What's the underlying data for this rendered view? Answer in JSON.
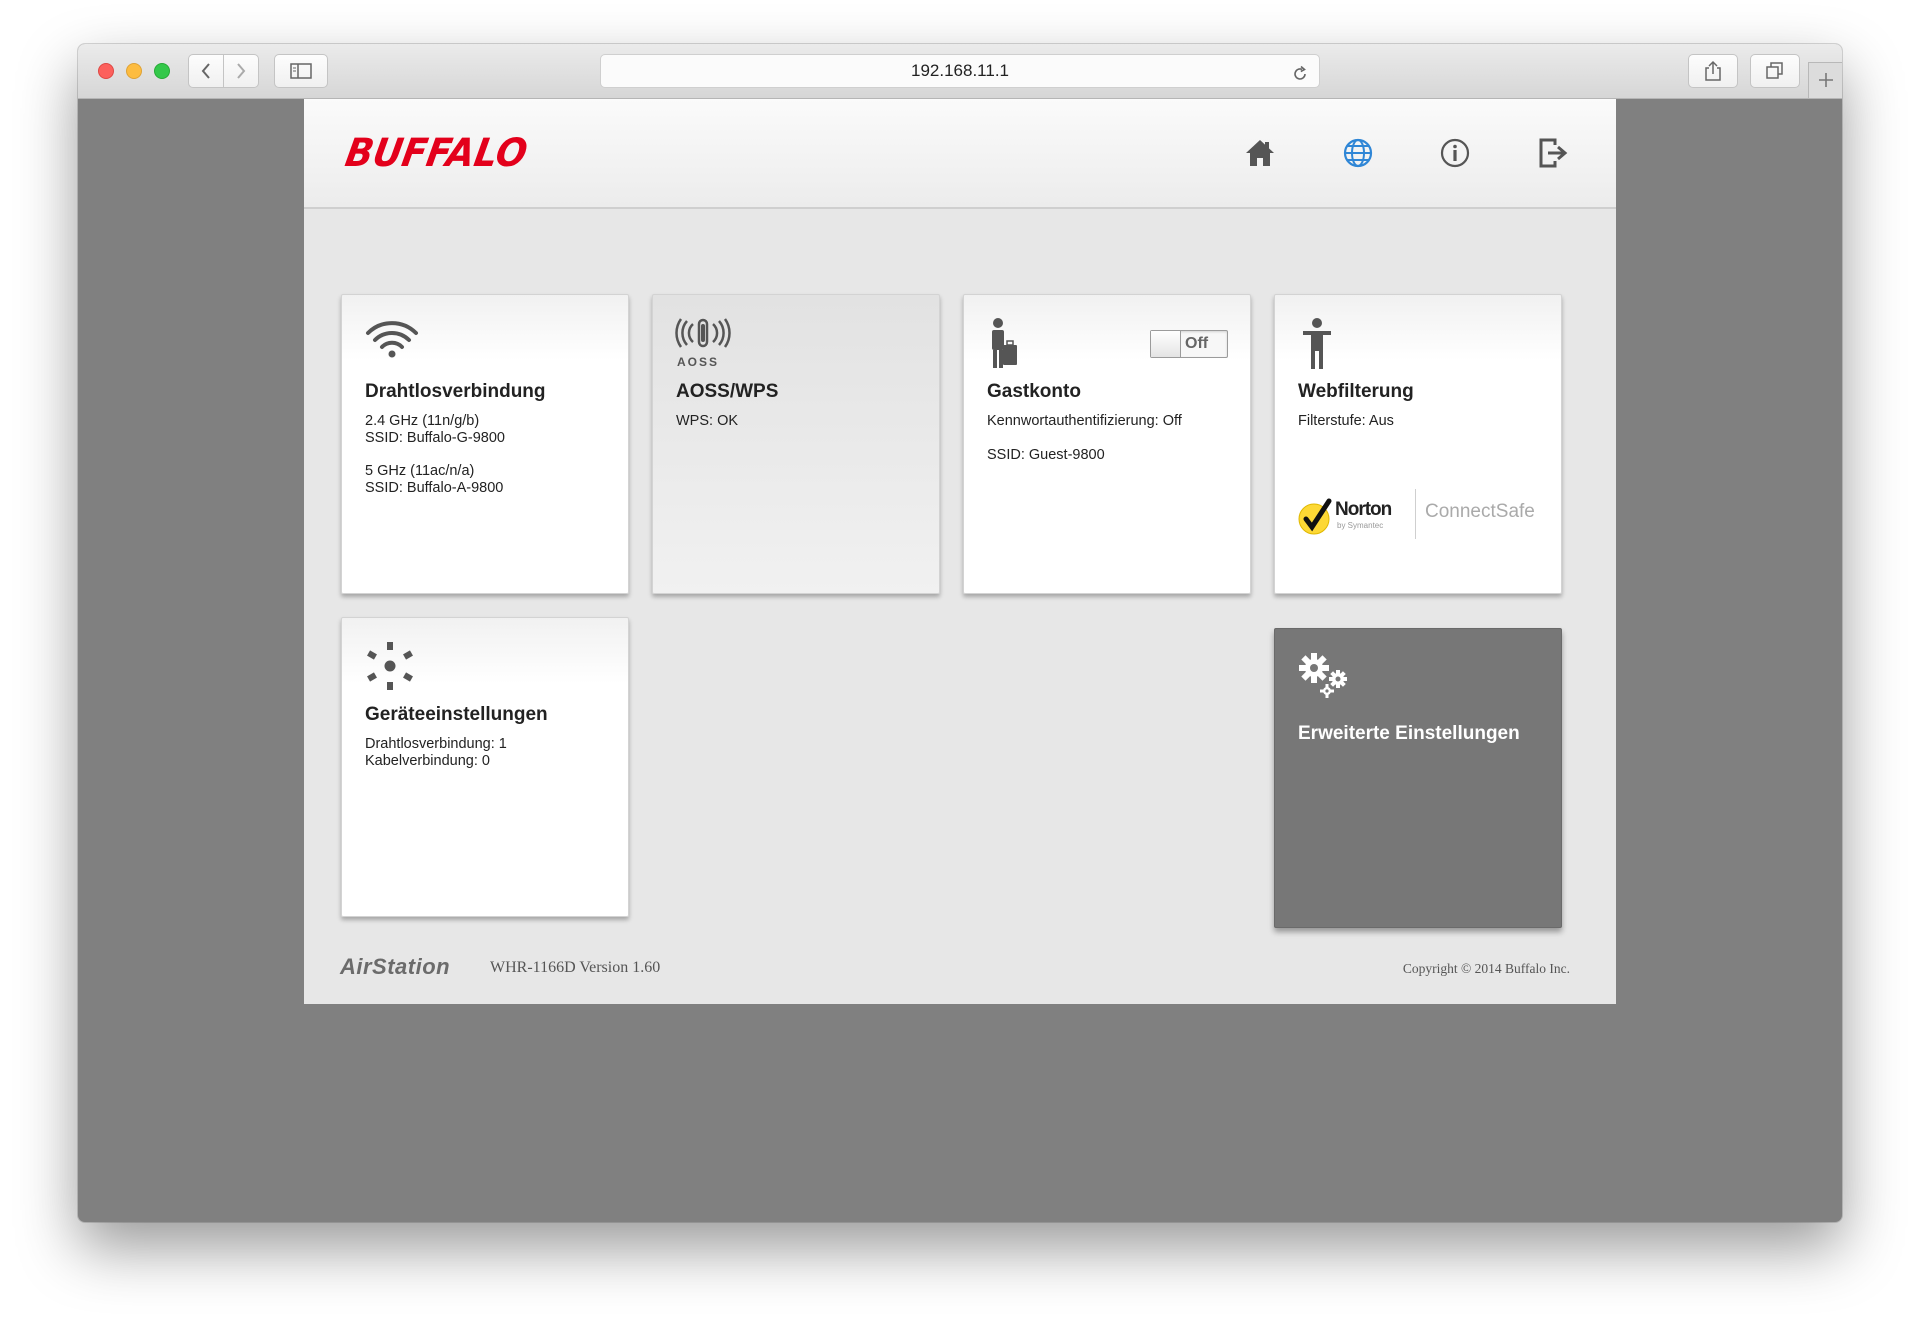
{
  "browser": {
    "url": "192.168.11.1",
    "icons": [
      "back-icon",
      "forward-icon",
      "sidebar-icon",
      "reload-icon",
      "share-icon",
      "tabs-icon",
      "plus-icon"
    ]
  },
  "header": {
    "logo": "BUFFALO",
    "nav_icons": [
      "home-icon",
      "globe-icon",
      "info-icon",
      "logout-icon"
    ],
    "accent_color": "#e3001b",
    "active_nav_color": "#2f86d6"
  },
  "tiles": {
    "wireless": {
      "title": "Drahtlosverbindung",
      "lines_24": [
        "2.4 GHz (11n/g/b)",
        "SSID: Buffalo-G-9800"
      ],
      "lines_5": [
        "5 GHz (11ac/n/a)",
        "SSID: Buffalo-A-9800"
      ]
    },
    "aoss": {
      "title": "AOSS/WPS",
      "icon_label": "AOSS",
      "status": "WPS: OK"
    },
    "guest": {
      "title": "Gastkonto",
      "toggle": "Off",
      "auth": "Kennwortauthentifizierung: Off",
      "ssid": "SSID: Guest-9800"
    },
    "webfilter": {
      "title": "Webfilterung",
      "level": "Filterstufe: Aus",
      "norton": "Norton",
      "norton_sub": "by Symantec",
      "connectsafe": "ConnectSafe"
    },
    "devices": {
      "title": "Geräteeinstellungen",
      "wireless": "Drahtlosverbindung: 1",
      "wired": "Kabelverbindung: 0"
    },
    "advanced": {
      "title": "Erweiterte Einstellungen"
    }
  },
  "footer": {
    "brand": "AirStation",
    "model": "WHR-1166D Version 1.60",
    "copyright": "Copyright © 2014 Buffalo Inc."
  }
}
